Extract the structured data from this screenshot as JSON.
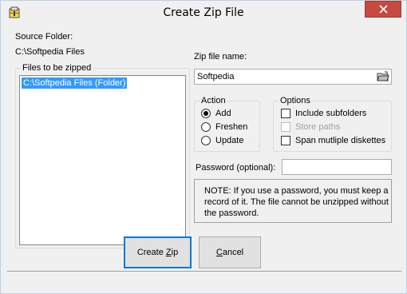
{
  "window": {
    "title": "Create Zip File"
  },
  "source": {
    "label": "Source Folder:",
    "path": "C:\\Softpedia Files"
  },
  "files": {
    "group_label": "Files to be zipped",
    "items": [
      "C:\\Softpedia Files (Folder)"
    ]
  },
  "zip": {
    "label": "Zip file name:",
    "value": "Softpedia"
  },
  "action": {
    "group_label": "Action",
    "options": [
      "Add",
      "Freshen",
      "Update"
    ],
    "selected": "Add"
  },
  "options": {
    "group_label": "Options",
    "include_subfolders": "Include subfolders",
    "store_paths": "Store paths",
    "span_diskettes": "Span mutliple diskettes"
  },
  "password": {
    "label": "Password (optional):",
    "value": ""
  },
  "note": {
    "text": "NOTE: If you use a password, you must keep a record of it. The file cannot be unzipped without the password."
  },
  "buttons": {
    "create_zip_pre": "Create ",
    "create_zip_key": "Z",
    "create_zip_post": "ip",
    "cancel_key": "C",
    "cancel_post": "ancel"
  },
  "icons": {
    "app": "zip-archive-icon",
    "browse": "open-folder-icon",
    "close": "close-icon"
  },
  "colors": {
    "selection": "#3399ff",
    "close": "#c74a3f",
    "default_button_border": "#0078d7"
  }
}
